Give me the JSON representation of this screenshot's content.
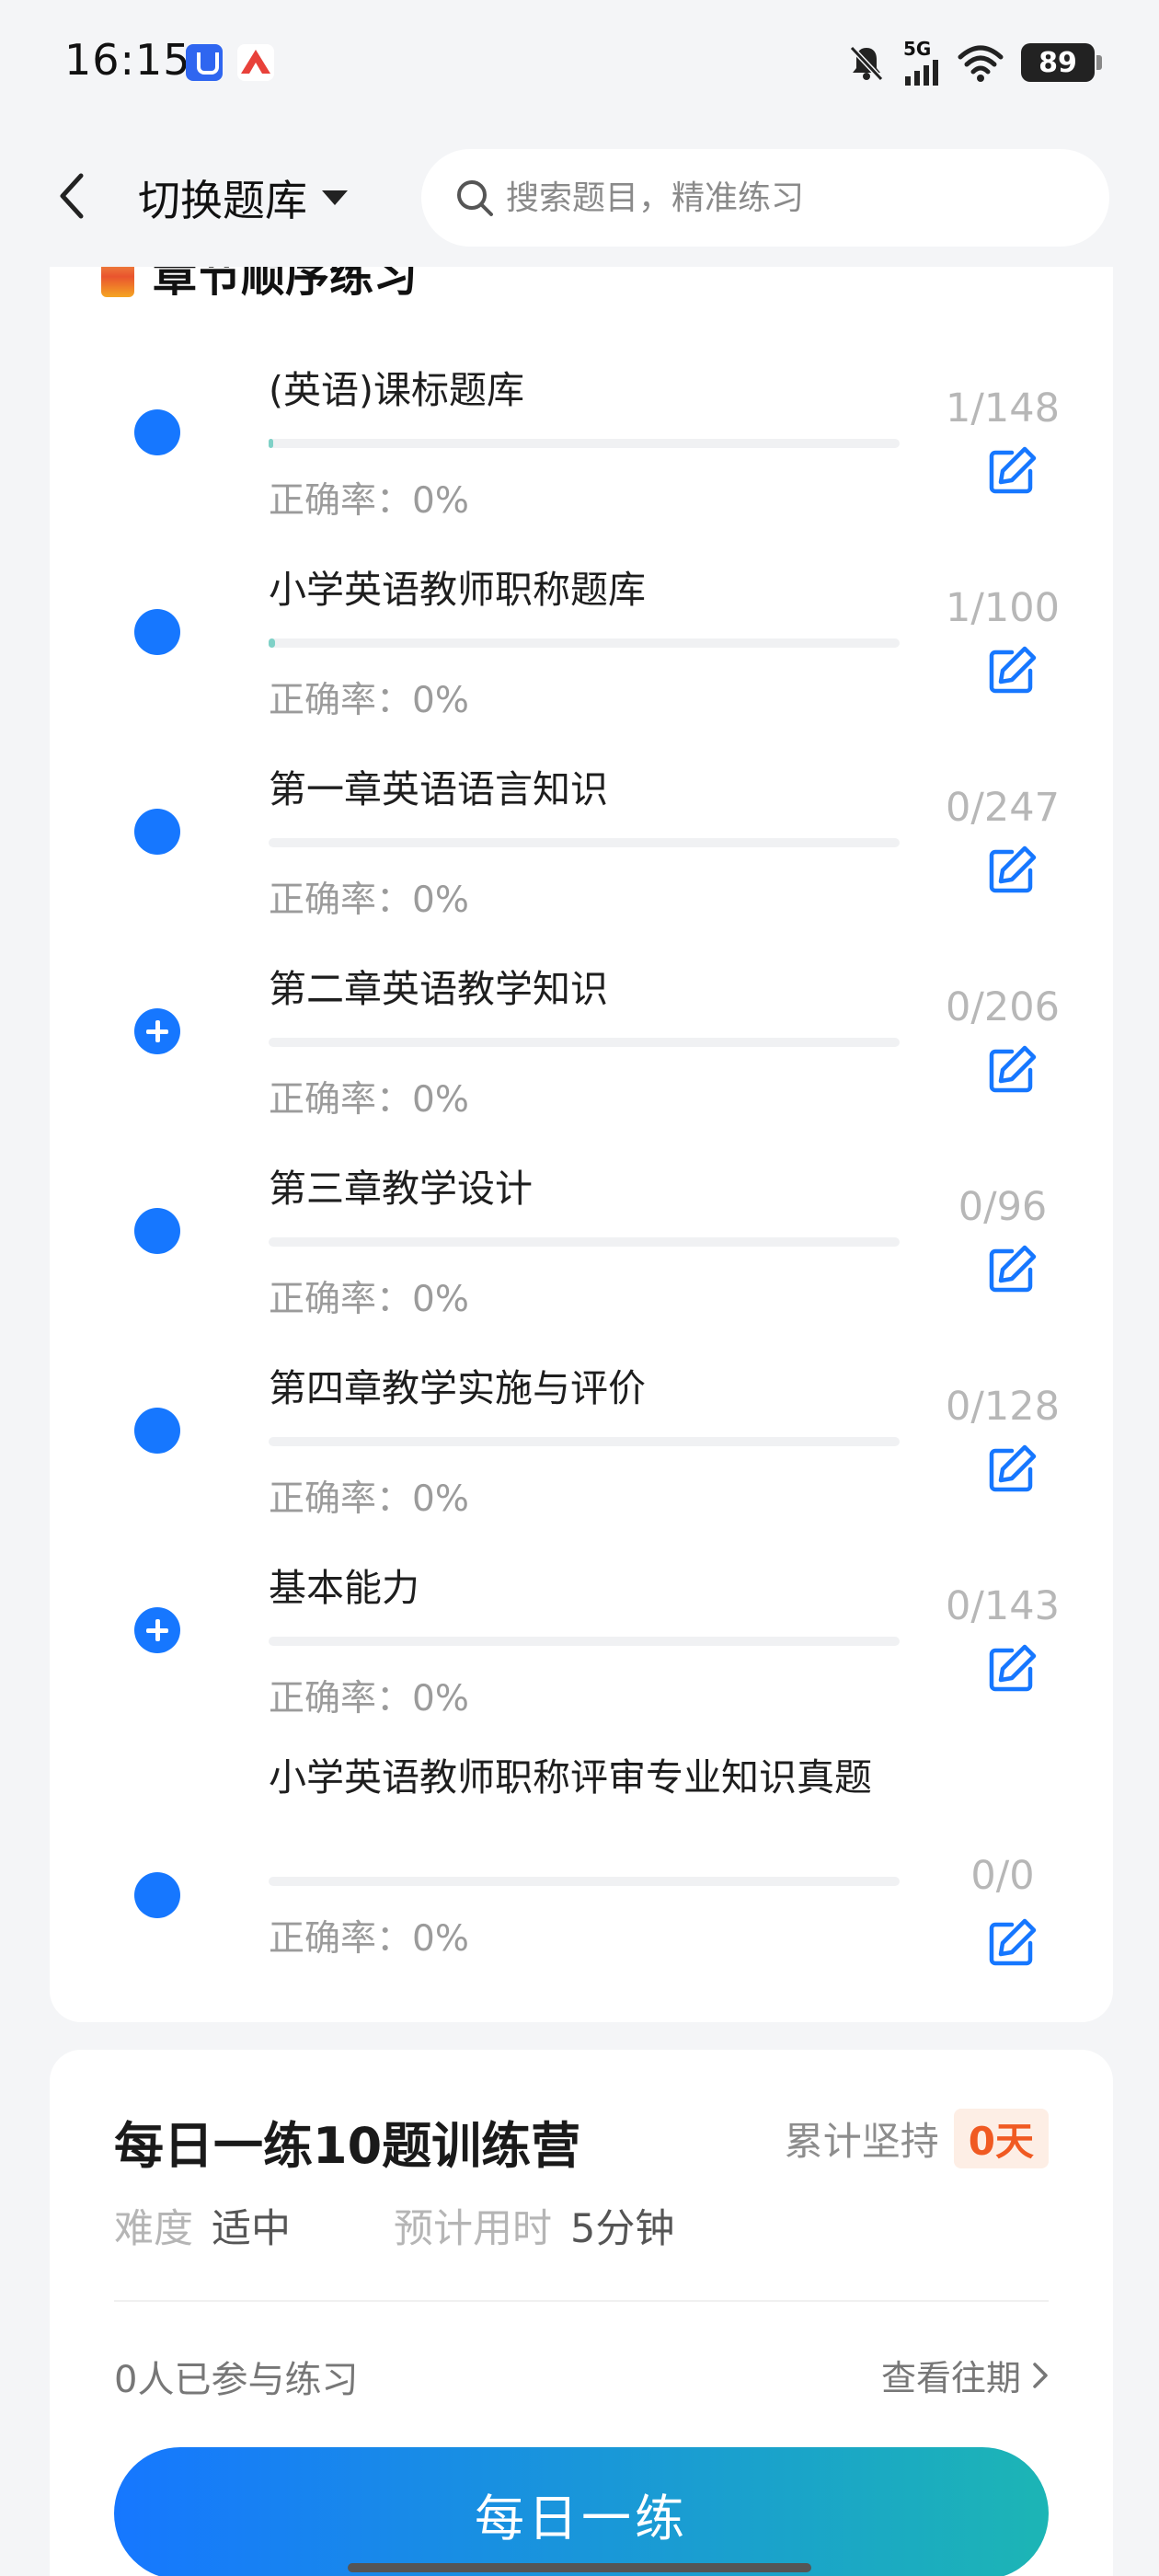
{
  "status_bar": {
    "time": "16:15",
    "network": "5G",
    "battery": "89",
    "icons": [
      "app-shield-icon",
      "app-mountain-icon",
      "bell-muted-icon",
      "signal-icon",
      "wifi-icon",
      "battery-icon"
    ]
  },
  "header": {
    "switch_label": "切换题库",
    "search_placeholder": "搜索题目，精准练习"
  },
  "chapter_section": {
    "title": "章节顺序练习",
    "items": [
      {
        "name": "(英语)课标题库",
        "count": "1/148",
        "accuracy": "正确率：0%",
        "progress": 0.007,
        "expandable": false
      },
      {
        "name": "小学英语教师职称题库",
        "count": "1/100",
        "accuracy": "正确率：0%",
        "progress": 0.01,
        "expandable": false
      },
      {
        "name": "第一章英语语言知识",
        "count": "0/247",
        "accuracy": "正确率：0%",
        "progress": 0,
        "expandable": false
      },
      {
        "name": "第二章英语教学知识",
        "count": "0/206",
        "accuracy": "正确率：0%",
        "progress": 0,
        "expandable": true
      },
      {
        "name": "第三章教学设计",
        "count": "0/96",
        "accuracy": "正确率：0%",
        "progress": 0,
        "expandable": false
      },
      {
        "name": "第四章教学实施与评价",
        "count": "0/128",
        "accuracy": "正确率：0%",
        "progress": 0,
        "expandable": false
      },
      {
        "name": "基本能力",
        "count": "0/143",
        "accuracy": "正确率：0%",
        "progress": 0,
        "expandable": true
      },
      {
        "name": "小学英语教师职称评审专业知识真题",
        "count": "0/0",
        "accuracy": "正确率：0%",
        "progress": 0,
        "expandable": false
      }
    ]
  },
  "daily_practice": {
    "title": "每日一练10题训练营",
    "streak_label": "累计坚持",
    "streak_days": "0天",
    "difficulty_label": "难度",
    "difficulty_value": "适中",
    "time_label": "预计用时",
    "time_value": "5分钟",
    "participants": "0人已参与练习",
    "history_link": "查看往期",
    "button_label": "每日一练"
  },
  "colors": {
    "accent": "#1677ff",
    "progress_fill": "#7fd1c7",
    "streak_text": "#f05a22",
    "button_gradient_end": "#1cb5b5"
  }
}
